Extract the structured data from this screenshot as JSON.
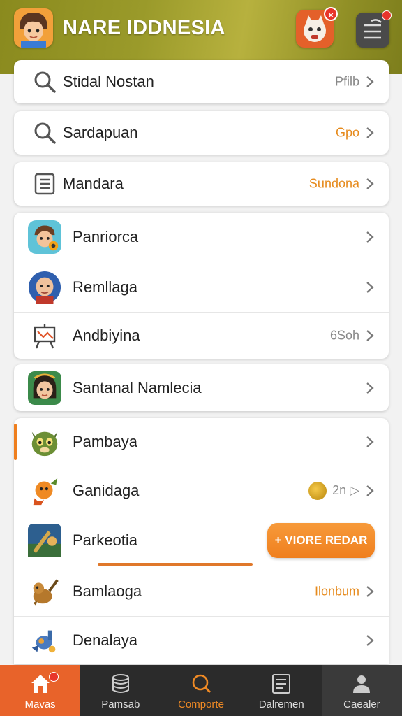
{
  "header": {
    "title": "NARE IDDNESIA",
    "mascot_badge": "×"
  },
  "search_rows": [
    {
      "label": "Stidal Nostan",
      "value": "Pfilb",
      "value_color": "gray",
      "icon": "search-icon"
    },
    {
      "label": "Sardapuan",
      "value": "Gpo",
      "value_color": "orange",
      "icon": "search-icon"
    },
    {
      "label": "Mandara",
      "value": "Sundona",
      "value_color": "orange",
      "icon": "list-icon"
    }
  ],
  "group1": [
    {
      "label": "Panriorca",
      "value": "",
      "avatar": "hero-boy"
    },
    {
      "label": "Remllaga",
      "value": "",
      "avatar": "hero-bald"
    },
    {
      "label": "Andbiyina",
      "value": "6Soh",
      "avatar": "easel-icon"
    }
  ],
  "single": {
    "label": "Santanal Namlecia",
    "avatar": "hero-girl"
  },
  "group2": [
    {
      "label": "Pambaya",
      "value": "",
      "avatar": "creature-green"
    },
    {
      "label": "Ganidaga",
      "value": "2n",
      "avatar": "creature-orange"
    },
    {
      "label": "Parkeotia",
      "value": "",
      "avatar": "scene-blue",
      "button": "+ VIORE REDAR"
    },
    {
      "label": "Bamlaoga",
      "value": "Ilonbum",
      "avatar": "creature-brown"
    },
    {
      "label": "Denalaya",
      "value": "",
      "avatar": "creature-robot"
    }
  ],
  "bottom_nav": [
    {
      "label": "Mavas",
      "icon": "home-icon"
    },
    {
      "label": "Pamsab",
      "icon": "database-icon"
    },
    {
      "label": "Comporte",
      "icon": "search-icon"
    },
    {
      "label": "Dalremen",
      "icon": "document-icon"
    },
    {
      "label": "Caealer",
      "icon": "user-icon"
    }
  ],
  "colors": {
    "accent": "#ef7f1e",
    "nav_bg": "#2b2b2b",
    "header": "#9a9a2a"
  }
}
